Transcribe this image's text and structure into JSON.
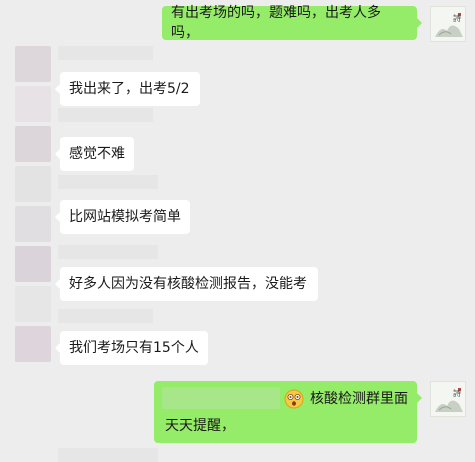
{
  "chat": {
    "messages": [
      {
        "side": "right",
        "text": "有出考场的吗，题难吗，出考人多吗，"
      },
      {
        "side": "left",
        "text": "我出来了，出考5/2"
      },
      {
        "side": "left",
        "text": "感觉不难"
      },
      {
        "side": "left",
        "text": "比网站模拟考简单"
      },
      {
        "side": "left",
        "text": "好多人因为没有核酸检测报告，没能考"
      },
      {
        "side": "left",
        "text": "我们考场只有15个人"
      },
      {
        "side": "right",
        "text_after_emoji": "核酸检测群里面",
        "text_line2": "天天提醒，",
        "emoji": "dizzy-face-emoji"
      }
    ]
  },
  "colors": {
    "background": "#ededed",
    "incoming_bubble": "#ffffff",
    "outgoing_bubble": "#95ec69",
    "redaction": "#e6e6e6"
  }
}
